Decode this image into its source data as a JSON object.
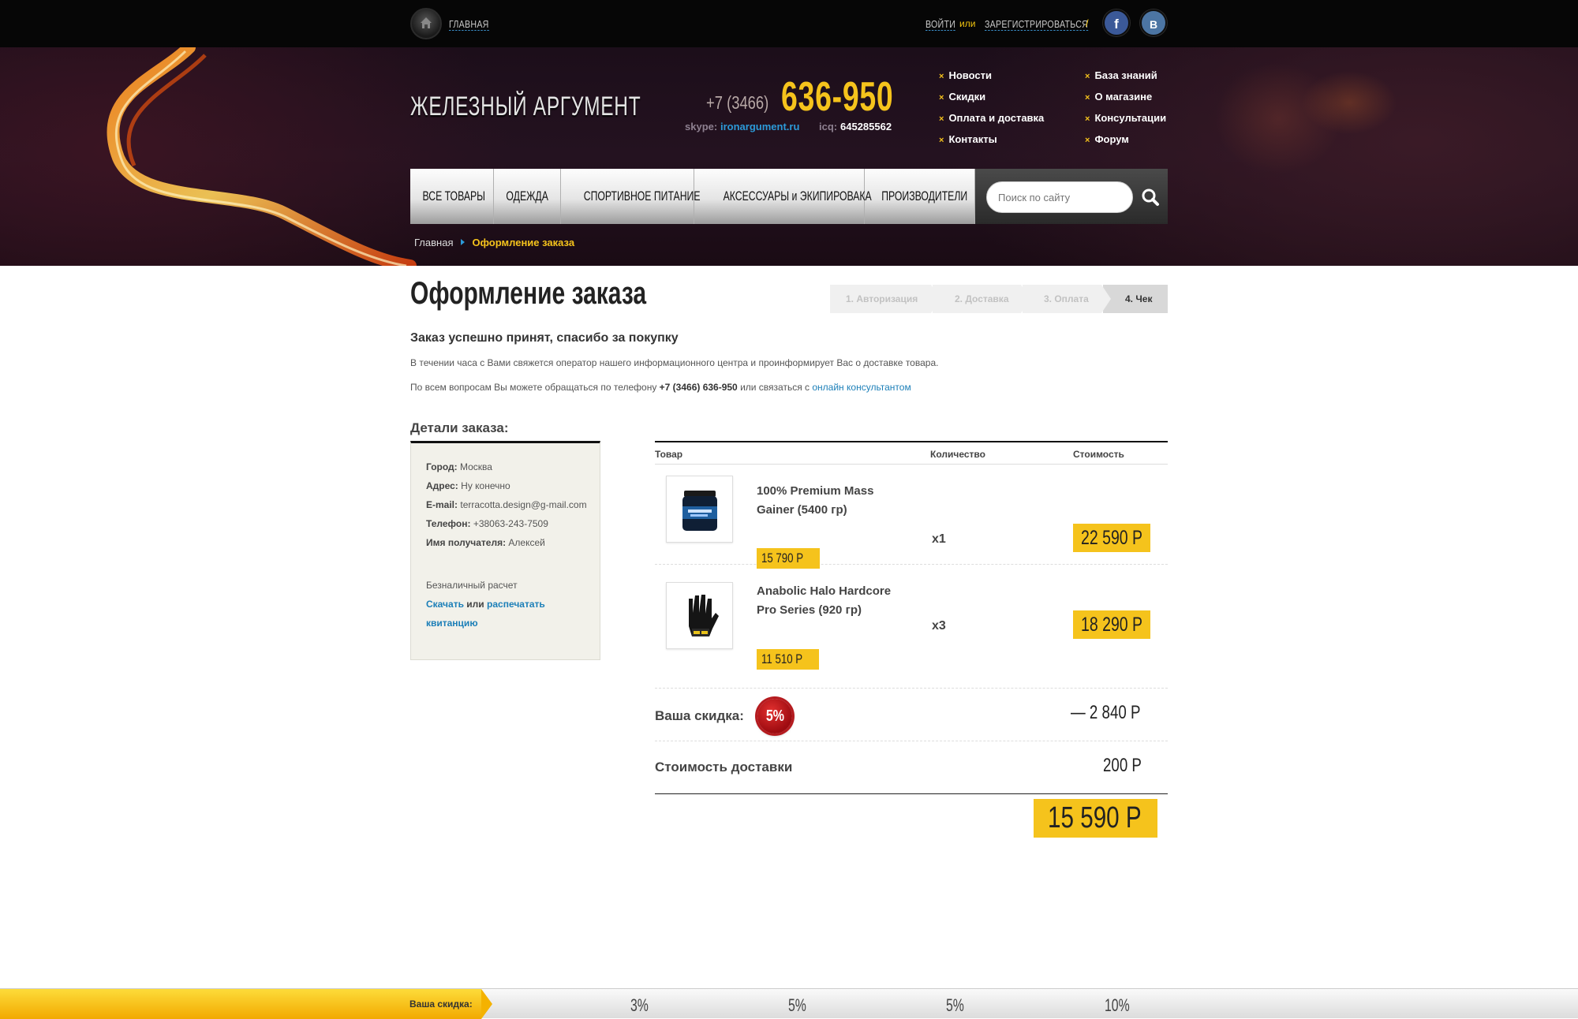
{
  "topbar": {
    "home_label": "ГЛАВНАЯ",
    "login_label": "ВОЙТИ",
    "or_text": "или",
    "register_label": "ЗАРЕГИСТРИРОВАТЬСЯ",
    "separator": "/",
    "facebook_glyph": "f",
    "vk_glyph": "B"
  },
  "header": {
    "logo_text": "ЖЕЛЕЗНЫЙ АРГУМЕНТ",
    "phone_prefix": "+7 (3466)",
    "phone_main": "636-950",
    "skype_label": "skype:",
    "skype_value": "ironargument.ru",
    "icq_label": "icq:",
    "icq_value": "645285562",
    "menu_left": [
      "Новости",
      "Скидки",
      "Оплата и доставка",
      "Контакты"
    ],
    "menu_right": [
      "База знаний",
      "О магазине",
      "Консультации",
      "Форум"
    ],
    "menu_marker": "×"
  },
  "nav": {
    "items": [
      "ВСЕ ТОВАРЫ",
      "ОДЕЖДА",
      "СПОРТИВНОЕ ПИТАНИЕ",
      "АКСЕССУАРЫ и ЭКИПИРОВАКА",
      "ПРОИЗВОДИТЕЛИ"
    ],
    "search_placeholder": "Поиск по сайту"
  },
  "breadcrumb": {
    "home": "Главная",
    "current": "Оформление заказа"
  },
  "page": {
    "title": "Оформление заказа",
    "steps": [
      "1. Авторизация",
      "2. Доставка",
      "3. Оплата",
      "4. Чек"
    ],
    "active_step": 4,
    "success_title": "Заказ успешно принят, спасибо за покупку",
    "info_line1": "В течении часа с Вами свяжется оператор нашего информационного центра и проинформирует Вас о доставке товара.",
    "info_line2_prefix": "По всем вопросам Вы можете обращаться по телефону ",
    "info_line2_phone": "+7 (3466) 636-950",
    "info_line2_middle": " или связаться с ",
    "info_line2_link": "онлайн консультантом"
  },
  "details": {
    "title": "Детали заказа:",
    "city_label": "Город:",
    "city": "Москва",
    "address_label": "Адрес:",
    "address": "Ну конечно",
    "email_label": "E-mail:",
    "email": "terracotta.design@g-mail.com",
    "phone_label": "Телефон:",
    "phone": "+38063-243-7509",
    "recipient_label": "Имя получателя:",
    "recipient": "Алексей",
    "payment": "Безналичный расчет",
    "download_link": "Скачать",
    "or_text": "или",
    "print_link": "распечатать квитанцию"
  },
  "order": {
    "col_product": "Товар",
    "col_qty": "Количество",
    "col_cost": "Стоимость",
    "items": [
      {
        "name": "100% Premium Mass Gainer (5400 гр)",
        "unit_price": "15 790 Р",
        "qty": "x1",
        "total": "22 590 Р"
      },
      {
        "name": "Anabolic Halo Hardcore Pro Series (920 гр)",
        "unit_price": "11 510 Р",
        "qty": "x3",
        "total": "18 290 Р"
      }
    ],
    "discount_label": "Ваша скидка:",
    "discount_badge": "5%",
    "discount_value": "— 2 840 Р",
    "delivery_label": "Стоимость доставки",
    "delivery_value": "200 Р",
    "grand_total": "15 590 Р"
  },
  "bottom_bar": {
    "label": "Ваша скидка:",
    "levels": [
      "3%",
      "5%",
      "5%",
      "10%"
    ]
  },
  "colors": {
    "accent_yellow": "#f5c31c",
    "link_blue": "#1c7fb8",
    "discount_red": "#c4161c",
    "header_dark": "#1c0e1a"
  }
}
